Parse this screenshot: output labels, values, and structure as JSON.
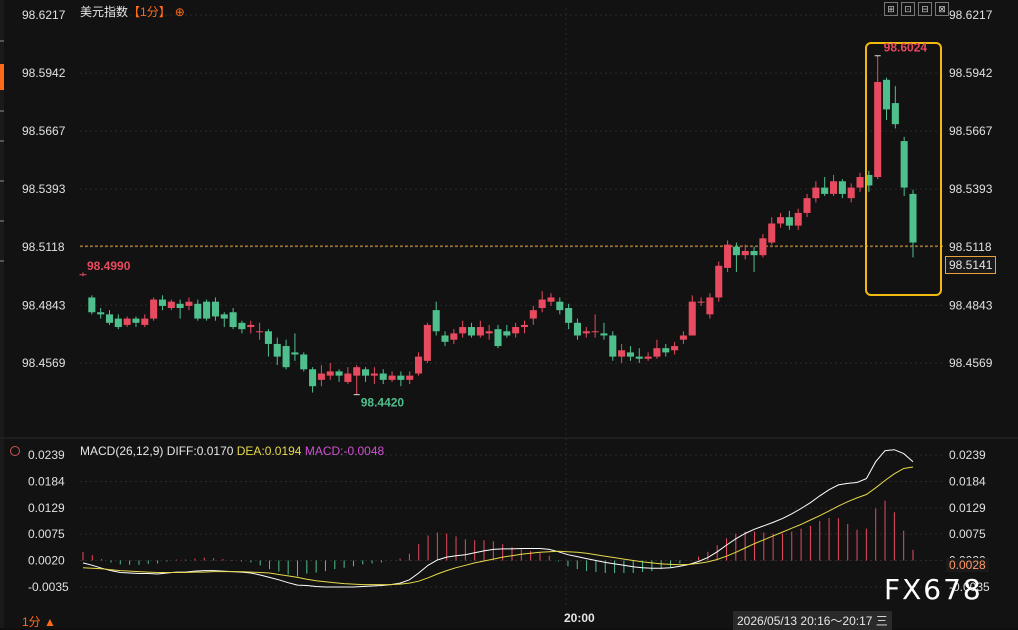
{
  "header": {
    "symbol": "美元指数",
    "period_bracket": "【1分】",
    "gear_glyph": "⊕",
    "toolbar": [
      "⊞",
      "⊡",
      "⊟",
      "⊠"
    ]
  },
  "price_axis": {
    "ticks": [
      "98.6217",
      "98.5942",
      "98.5667",
      "98.5393",
      "98.5118",
      "98.4843",
      "98.4569"
    ],
    "ylim": [
      98.43,
      98.625
    ]
  },
  "annotations": {
    "high_label": "98.6024",
    "low_label": "98.4420",
    "left_label": "98.4990",
    "last_price": "98.5141",
    "reference_price": "98.5123"
  },
  "macd_header": {
    "name": "MACD(26,12,9)",
    "diff": "DIFF:0.0170",
    "dea": "DEA:0.0194",
    "macd": "MACD:-0.0048"
  },
  "macd_axis": {
    "ticks": [
      "0.0239",
      "0.0184",
      "0.0129",
      "0.0075",
      "0.0020",
      "-0.0035"
    ],
    "ylim": [
      -0.0062,
      0.0239
    ],
    "last_value": "0.0028"
  },
  "footer": {
    "period": "1分 ▲",
    "time_label": "20:00",
    "range": "2026/05/13 20:16～20:17 三",
    "watermark": "FX678"
  },
  "colors": {
    "up": "#e84a5f",
    "down": "#4fc08d",
    "diff_line": "#ffffff",
    "dea_line": "#e6d94a",
    "highlight_box": "#f2b90f",
    "reference_line": "#e8a13a",
    "accent": "#ff6a1a"
  },
  "chart_data": [
    {
      "type": "candlestick",
      "ylim": [
        98.43,
        98.625
      ],
      "grid": true,
      "candles": [
        [
          98.499,
          98.499,
          98.4999,
          98.498
        ],
        [
          98.488,
          98.481,
          98.489,
          98.48
        ],
        [
          98.481,
          98.48,
          98.483,
          98.478
        ],
        [
          98.48,
          98.476,
          98.482,
          98.475
        ],
        [
          98.478,
          98.474,
          98.48,
          98.473
        ],
        [
          98.475,
          98.478,
          98.479,
          98.474
        ],
        [
          98.478,
          98.476,
          98.479,
          98.474
        ],
        [
          98.475,
          98.478,
          98.48,
          98.474
        ],
        [
          98.478,
          98.487,
          98.488,
          98.477
        ],
        [
          98.487,
          98.484,
          98.489,
          98.482
        ],
        [
          98.483,
          98.486,
          98.487,
          98.482
        ],
        [
          98.485,
          98.483,
          98.487,
          98.478
        ],
        [
          98.484,
          98.486,
          98.488,
          98.482
        ],
        [
          98.485,
          98.478,
          98.487,
          98.477
        ],
        [
          98.486,
          98.478,
          98.487,
          98.477
        ],
        [
          98.486,
          98.479,
          98.488,
          98.477
        ],
        [
          98.48,
          98.478,
          98.481,
          98.474
        ],
        [
          98.481,
          98.474,
          98.483,
          98.473
        ],
        [
          98.476,
          98.473,
          98.477,
          98.471
        ],
        [
          98.474,
          98.475,
          98.477,
          98.471
        ],
        [
          98.472,
          98.472,
          98.476,
          98.468
        ],
        [
          98.472,
          98.466,
          98.473,
          98.46
        ],
        [
          98.466,
          98.46,
          98.469,
          98.456
        ],
        [
          98.465,
          98.455,
          98.468,
          98.454
        ],
        [
          98.462,
          98.461,
          98.471,
          98.458
        ],
        [
          98.461,
          98.454,
          98.462,
          98.453
        ],
        [
          98.454,
          98.446,
          98.455,
          98.443
        ],
        [
          98.449,
          98.452,
          98.456,
          98.446
        ],
        [
          98.451,
          98.453,
          98.457,
          98.449
        ],
        [
          98.453,
          98.451,
          98.454,
          98.448
        ],
        [
          98.448,
          98.452,
          98.455,
          98.447
        ],
        [
          98.451,
          98.455,
          98.456,
          98.442
        ],
        [
          98.454,
          98.451,
          98.455,
          98.448
        ],
        [
          98.451,
          98.452,
          98.455,
          98.447
        ],
        [
          98.452,
          98.449,
          98.454,
          98.447
        ],
        [
          98.449,
          98.451,
          98.453,
          98.448
        ],
        [
          98.451,
          98.449,
          98.453,
          98.446
        ],
        [
          98.449,
          98.451,
          98.453,
          98.447
        ],
        [
          98.452,
          98.46,
          98.462,
          98.451
        ],
        [
          98.458,
          98.475,
          98.476,
          98.457
        ],
        [
          98.482,
          98.472,
          98.486,
          98.47
        ],
        [
          98.47,
          98.467,
          98.472,
          98.465
        ],
        [
          98.468,
          98.471,
          98.473,
          98.466
        ],
        [
          98.471,
          98.474,
          98.477,
          98.469
        ],
        [
          98.474,
          98.47,
          98.476,
          98.469
        ],
        [
          98.47,
          98.474,
          98.477,
          98.469
        ],
        [
          98.471,
          98.472,
          98.475,
          98.468
        ],
        [
          98.473,
          98.465,
          98.475,
          98.464
        ],
        [
          98.472,
          98.47,
          98.475,
          98.469
        ],
        [
          98.471,
          98.474,
          98.476,
          98.469
        ],
        [
          98.474,
          98.475,
          98.477,
          98.471
        ],
        [
          98.478,
          98.482,
          98.484,
          98.475
        ],
        [
          98.483,
          98.487,
          98.491,
          98.481
        ],
        [
          98.486,
          98.488,
          98.49,
          98.484
        ],
        [
          98.486,
          98.482,
          98.488,
          98.48
        ],
        [
          98.483,
          98.476,
          98.485,
          98.473
        ],
        [
          98.476,
          98.47,
          98.478,
          98.468
        ],
        [
          98.471,
          98.472,
          98.474,
          98.469
        ],
        [
          98.472,
          98.472,
          98.48,
          98.469
        ],
        [
          98.471,
          98.47,
          98.476,
          98.468
        ],
        [
          98.47,
          98.46,
          98.472,
          98.458
        ],
        [
          98.46,
          98.463,
          98.466,
          98.457
        ],
        [
          98.462,
          98.46,
          98.465,
          98.458
        ],
        [
          98.46,
          98.459,
          98.464,
          98.457
        ],
        [
          98.459,
          98.46,
          98.462,
          98.458
        ],
        [
          98.46,
          98.464,
          98.468,
          98.459
        ],
        [
          98.464,
          98.462,
          98.466,
          98.46
        ],
        [
          98.463,
          98.465,
          98.467,
          98.461
        ],
        [
          98.468,
          98.47,
          98.472,
          98.466
        ],
        [
          98.47,
          98.486,
          98.489,
          98.47
        ],
        [
          98.486,
          98.486,
          98.488,
          98.484
        ],
        [
          98.48,
          98.488,
          98.49,
          98.478
        ],
        [
          98.488,
          98.503,
          98.505,
          98.486
        ],
        [
          98.502,
          98.513,
          98.515,
          98.5
        ],
        [
          98.512,
          98.508,
          98.514,
          98.5
        ],
        [
          98.508,
          98.51,
          98.513,
          98.506
        ],
        [
          98.51,
          98.508,
          98.512,
          98.5
        ],
        [
          98.508,
          98.516,
          98.518,
          98.507
        ],
        [
          98.514,
          98.523,
          98.526,
          98.513
        ],
        [
          98.523,
          98.526,
          98.528,
          98.521
        ],
        [
          98.526,
          98.522,
          98.529,
          98.52
        ],
        [
          98.522,
          98.528,
          98.53,
          98.52
        ],
        [
          98.528,
          98.535,
          98.537,
          98.526
        ],
        [
          98.535,
          98.54,
          98.543,
          98.533
        ],
        [
          98.54,
          98.537,
          98.545,
          98.536
        ],
        [
          98.537,
          98.543,
          98.546,
          98.536
        ],
        [
          98.543,
          98.537,
          98.544,
          98.535
        ],
        [
          98.535,
          98.54,
          98.542,
          98.533
        ],
        [
          98.54,
          98.545,
          98.547,
          98.538
        ],
        [
          98.546,
          98.541,
          98.548,
          98.538
        ],
        [
          98.545,
          98.59,
          98.6024,
          98.544
        ],
        [
          98.591,
          98.577,
          98.592,
          98.572
        ],
        [
          98.58,
          98.57,
          98.588,
          98.568
        ],
        [
          98.562,
          98.54,
          98.564,
          98.536
        ],
        [
          98.537,
          98.514,
          98.539,
          98.507
        ]
      ]
    },
    {
      "type": "line",
      "ylim": [
        -0.0062,
        0.0239
      ],
      "series": [
        {
          "name": "DIFF",
          "values": [
            -0.0005,
            -0.001,
            -0.0016,
            -0.0021,
            -0.0025,
            -0.0026,
            -0.0027,
            -0.0027,
            -0.0028,
            -0.0026,
            -0.0024,
            -0.0024,
            -0.0022,
            -0.0021,
            -0.0021,
            -0.0022,
            -0.0023,
            -0.0024,
            -0.0026,
            -0.003,
            -0.0035,
            -0.004,
            -0.0046,
            -0.0051,
            -0.0052,
            -0.0054,
            -0.0055,
            -0.0055,
            -0.0055,
            -0.0055,
            -0.0054,
            -0.0053,
            -0.0052,
            -0.005,
            -0.0047,
            -0.004,
            -0.0026,
            -0.001,
            0.0001,
            0.0007,
            0.001,
            0.0012,
            0.0016,
            0.002,
            0.0023,
            0.0024,
            0.0024,
            0.0025,
            0.0025,
            0.0025,
            0.0023,
            0.0018,
            0.0012,
            0.0008,
            0.0004,
            0.0,
            -0.0004,
            -0.0007,
            -0.001,
            -0.0013,
            -0.0015,
            -0.0016,
            -0.0016,
            -0.0015,
            -0.0012,
            -0.0008,
            -0.0002,
            0.0006,
            0.0018,
            0.0032,
            0.0045,
            0.0056,
            0.0065,
            0.0072,
            0.0079,
            0.0087,
            0.0097,
            0.0108,
            0.012,
            0.0134,
            0.0147,
            0.0157,
            0.016,
            0.0162,
            0.017,
            0.0205,
            0.0228,
            0.023,
            0.0222,
            0.0205
          ]
        },
        {
          "name": "DEA",
          "values": [
            -0.0015,
            -0.0016,
            -0.0017,
            -0.0019,
            -0.0021,
            -0.0022,
            -0.0023,
            -0.0024,
            -0.0025,
            -0.0025,
            -0.0025,
            -0.0025,
            -0.0024,
            -0.0024,
            -0.0023,
            -0.0023,
            -0.0023,
            -0.0023,
            -0.0024,
            -0.0025,
            -0.0026,
            -0.0029,
            -0.0032,
            -0.0035,
            -0.0039,
            -0.0042,
            -0.0044,
            -0.0046,
            -0.0048,
            -0.0049,
            -0.005,
            -0.005,
            -0.005,
            -0.005,
            -0.0049,
            -0.0047,
            -0.0043,
            -0.0036,
            -0.0028,
            -0.0021,
            -0.0015,
            -0.001,
            -0.0005,
            -0.0001,
            0.0003,
            0.0007,
            0.001,
            0.0013,
            0.0015,
            0.0017,
            0.0018,
            0.0019,
            0.0018,
            0.0017,
            0.0015,
            0.0012,
            0.0009,
            0.0006,
            0.0003,
            0.0,
            -0.0003,
            -0.0005,
            -0.0007,
            -0.0008,
            -0.0009,
            -0.0008,
            -0.0006,
            -0.0003,
            0.0002,
            0.0009,
            0.0017,
            0.0026,
            0.0035,
            0.0043,
            0.0051,
            0.0059,
            0.0067,
            0.0075,
            0.0084,
            0.0093,
            0.0103,
            0.0113,
            0.0122,
            0.013,
            0.0137,
            0.0151,
            0.0166,
            0.018,
            0.0191,
            0.0194
          ]
        }
      ]
    },
    {
      "type": "bar",
      "ylim": [
        -0.0062,
        0.0239
      ],
      "baseline": 0.002,
      "values": [
        0.0018,
        0.0011,
        0.0003,
        -0.0004,
        -0.0008,
        -0.0009,
        -0.0009,
        -0.0007,
        -0.0006,
        -0.0002,
        0.0002,
        0.0002,
        0.0004,
        0.0006,
        0.0005,
        0.0003,
        0.0001,
        -0.0002,
        -0.0004,
        -0.001,
        -0.0018,
        -0.0023,
        -0.0029,
        -0.0033,
        -0.0027,
        -0.0025,
        -0.0022,
        -0.0018,
        -0.0015,
        -0.0012,
        -0.0008,
        -0.0006,
        -0.0004,
        0.0,
        0.0004,
        0.0014,
        0.0034,
        0.0052,
        0.0058,
        0.0056,
        0.005,
        0.0044,
        0.0042,
        0.0042,
        0.004,
        0.0034,
        0.0028,
        0.0024,
        0.002,
        0.0016,
        0.001,
        -0.0002,
        -0.0012,
        -0.0018,
        -0.0022,
        -0.0024,
        -0.0026,
        -0.0026,
        -0.0026,
        -0.0026,
        -0.0024,
        -0.0022,
        -0.0018,
        -0.0014,
        -0.0006,
        0.0,
        0.0008,
        0.0018,
        0.0032,
        0.0046,
        0.0056,
        0.006,
        0.006,
        0.0058,
        0.0056,
        0.0056,
        0.006,
        0.0066,
        0.0072,
        0.0082,
        0.0088,
        0.0088,
        0.0076,
        0.0064,
        0.0066,
        0.0108,
        0.0124,
        0.01,
        0.0062,
        0.0022
      ]
    }
  ]
}
